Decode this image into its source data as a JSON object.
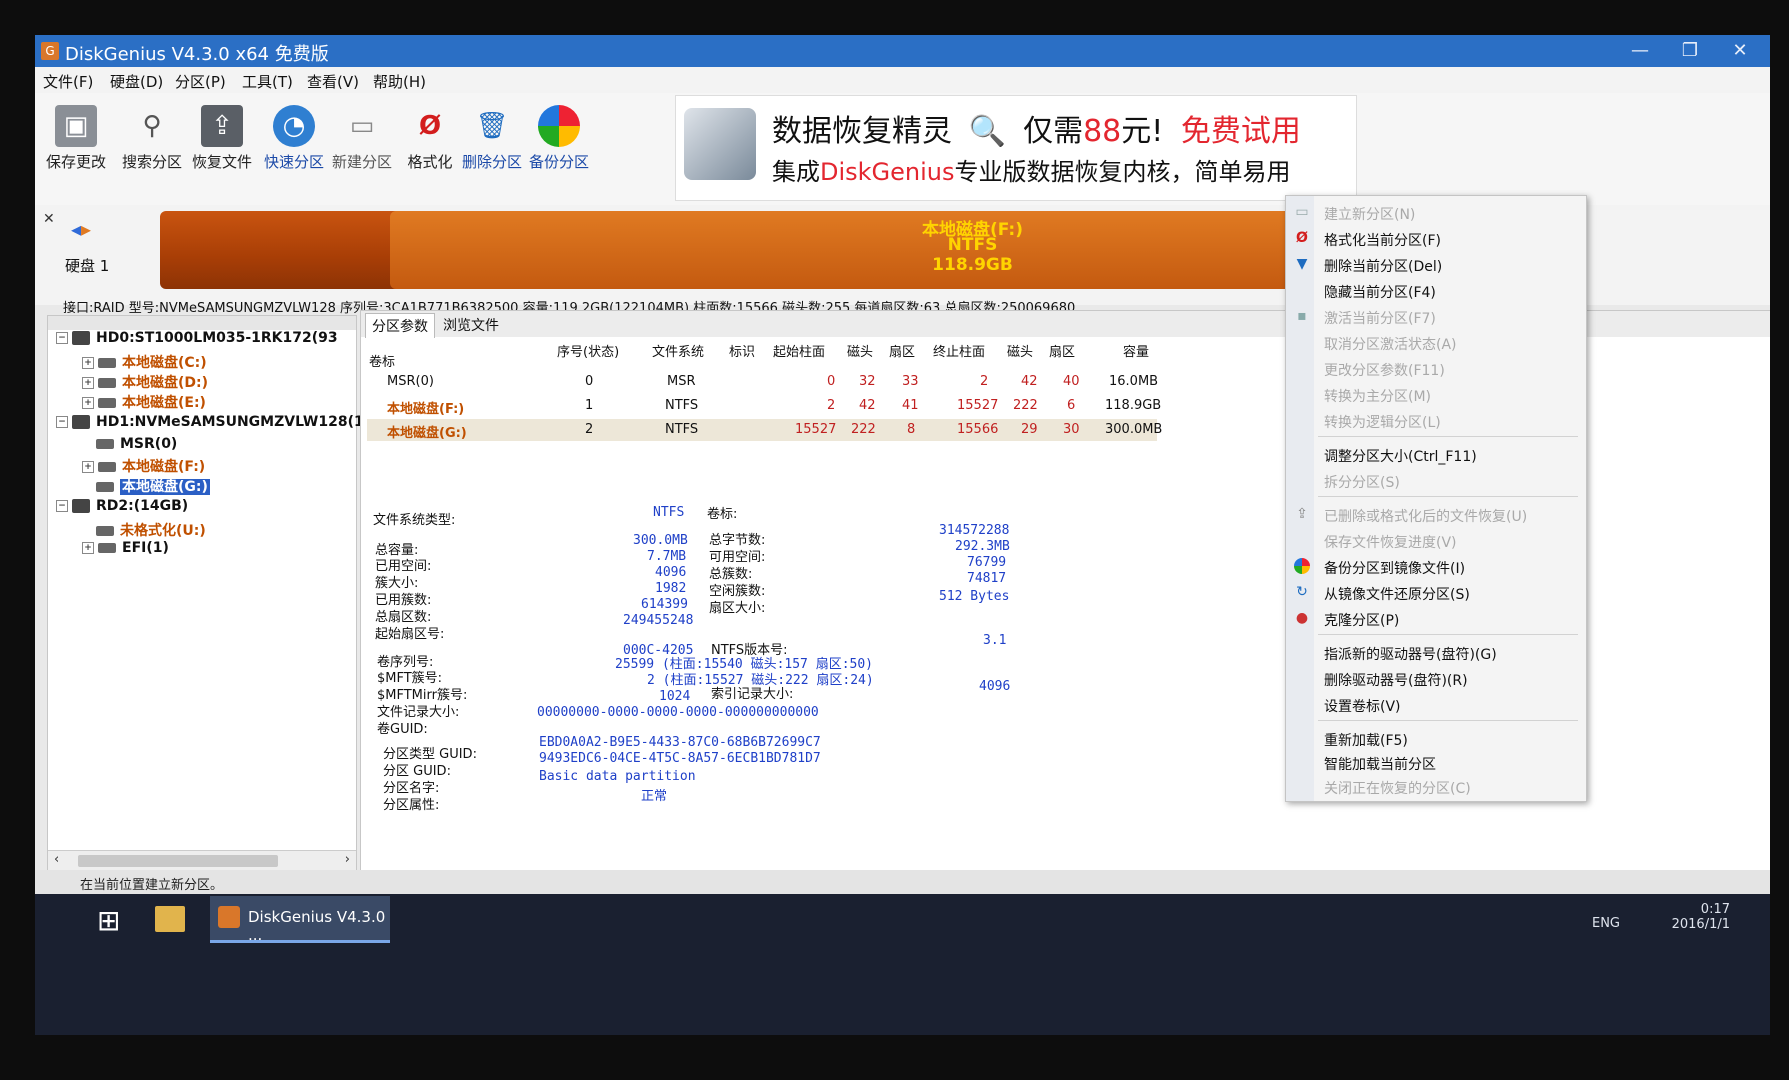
{
  "window": {
    "title": "DiskGenius V4.3.0 x64 免费版",
    "minimize": "—",
    "restore": "❐",
    "close": "✕"
  },
  "menu": [
    "文件(F)",
    "硬盘(D)",
    "分区(P)",
    "工具(T)",
    "查看(V)",
    "帮助(H)"
  ],
  "toolbar": [
    {
      "label": "保存更改",
      "icon": "save-icon"
    },
    {
      "label": "搜索分区",
      "icon": "search-icon"
    },
    {
      "label": "恢复文件",
      "icon": "recover-icon"
    },
    {
      "label": "快速分区",
      "icon": "quick-partition-icon"
    },
    {
      "label": "新建分区",
      "icon": "new-partition-icon"
    },
    {
      "label": "格式化",
      "icon": "format-icon"
    },
    {
      "label": "删除分区",
      "icon": "delete-icon"
    },
    {
      "label": "备份分区",
      "icon": "backup-icon"
    }
  ],
  "banner": {
    "t1": "数据恢复精灵",
    "t2": "仅需",
    "t3": "88",
    "t4": "元!",
    "t5": "免费试用",
    "l2a": "集成",
    "l2b": "DiskGenius",
    "l2c": "专业版数据恢复内核，简单易用"
  },
  "disk_bar": {
    "name": "本地磁盘(F:)",
    "fs": "NTFS",
    "size": "118.9GB",
    "disk_label": "硬盘 1"
  },
  "disk_info": "接口:RAID   型号:NVMeSAMSUNGMZVLW128   序列号:3CA1B771B6382500   容量:119.2GB(122104MB)   柱面数:15566   磁头数:255   每道扇区数:63   总扇区数:250069680",
  "tree": [
    {
      "text": "HD0:ST1000LM035-1RK172(93",
      "style": "black",
      "hdd": true
    },
    {
      "text": "本地磁盘(C:)",
      "style": "orange"
    },
    {
      "text": "本地磁盘(D:)",
      "style": "orange"
    },
    {
      "text": "本地磁盘(E:)",
      "style": "orange"
    },
    {
      "text": "HD1:NVMeSAMSUNGMZVLW128(1",
      "style": "black",
      "hdd": true
    },
    {
      "text": "MSR(0)",
      "style": "black"
    },
    {
      "text": "本地磁盘(F:)",
      "style": "orange"
    },
    {
      "text": "本地磁盘(G:)",
      "style": "selected"
    },
    {
      "text": "RD2:(14GB)",
      "style": "black",
      "hdd": true
    },
    {
      "text": "未格式化(U:)",
      "style": "orange"
    },
    {
      "text": "EFI(1)",
      "style": "black"
    }
  ],
  "tabs": [
    "分区参数",
    "浏览文件"
  ],
  "table": {
    "headers": [
      "卷标",
      "序号(状态)",
      "文件系统",
      "标识",
      "起始柱面",
      "磁头",
      "扇区",
      "终止柱面",
      "磁头",
      "扇区",
      "容量"
    ],
    "rows": [
      [
        "MSR(0)",
        "0",
        "MSR",
        "",
        "0",
        "32",
        "33",
        "2",
        "42",
        "40",
        "16.0MB"
      ],
      [
        "本地磁盘(F:)",
        "1",
        "NTFS",
        "",
        "2",
        "42",
        "41",
        "15527",
        "222",
        "6",
        "118.9GB"
      ],
      [
        "本地磁盘(G:)",
        "2",
        "NTFS",
        "",
        "15527",
        "222",
        "8",
        "15566",
        "29",
        "30",
        "300.0MB"
      ]
    ]
  },
  "details": {
    "fs_type_label": "文件系统类型:",
    "fs_type": "NTFS",
    "vol_label": "卷标:",
    "left_labels": [
      "总容量:",
      "已用空间:",
      "簇大小:",
      "已用簇数:",
      "总扇区数:",
      "起始扇区号:"
    ],
    "left_values": [
      "300.0MB",
      "7.7MB",
      "4096",
      "1982",
      "614399",
      "249455248"
    ],
    "right_labels": [
      "总字节数:",
      "可用空间:",
      "总簇数:",
      "空闲簇数:",
      "扇区大小:"
    ],
    "right_values": [
      "314572288",
      "292.3MB",
      "76799",
      "74817",
      "512 Bytes"
    ],
    "b_labels": [
      "卷序列号:",
      "$MFT簇号:",
      "$MFTMirr簇号:",
      "文件记录大小:",
      "卷GUID:"
    ],
    "serial": "000C-4205",
    "ntfs_ver_label": "NTFS版本号:",
    "ntfs_ver": "3.1",
    "mft": "25599 (柱面:15540 磁头:157 扇区:50)",
    "mftmirr": "2 (柱面:15527 磁头:222 扇区:24)",
    "record_size": "1024",
    "index_label": "索引记录大小:",
    "index_size": "4096",
    "vol_guid": "00000000-0000-0000-0000-000000000000",
    "c_labels": [
      "分区类型 GUID:",
      "分区 GUID:",
      "分区名字:",
      "分区属性:"
    ],
    "type_guid": "EBD0A0A2-B9E5-4433-87C0-68B6B72699C7",
    "part_guid": "9493EDC6-04CE-4T5C-8A57-6ECB1BD781D7",
    "part_name": "Basic data partition",
    "part_attr": "正常"
  },
  "context_menu": [
    {
      "label": "建立新分区(N)",
      "enabled": false,
      "icon": "new-partition-icon"
    },
    {
      "label": "格式化当前分区(F)",
      "enabled": true,
      "icon": "format-icon"
    },
    {
      "label": "删除当前分区(Del)",
      "enabled": true,
      "icon": "delete-icon"
    },
    {
      "label": "隐藏当前分区(F4)",
      "enabled": true,
      "icon": ""
    },
    {
      "label": "激活当前分区(F7)",
      "enabled": false,
      "icon": "activate-icon"
    },
    {
      "label": "取消分区激活状态(A)",
      "enabled": false,
      "icon": ""
    },
    {
      "label": "更改分区参数(F11)",
      "enabled": false,
      "icon": ""
    },
    {
      "label": "转换为主分区(M)",
      "enabled": false,
      "icon": ""
    },
    {
      "label": "转换为逻辑分区(L)",
      "enabled": false,
      "icon": ""
    },
    {
      "sep": true
    },
    {
      "label": "调整分区大小(Ctrl_F11)",
      "enabled": true,
      "icon": ""
    },
    {
      "label": "拆分分区(S)",
      "enabled": false,
      "icon": ""
    },
    {
      "sep": true
    },
    {
      "label": "已删除或格式化后的文件恢复(U)",
      "enabled": false,
      "icon": "recover-icon"
    },
    {
      "label": "保存文件恢复进度(V)",
      "enabled": false,
      "icon": ""
    },
    {
      "label": "备份分区到镜像文件(I)",
      "enabled": true,
      "icon": "backup-icon"
    },
    {
      "label": "从镜像文件还原分区(S)",
      "enabled": true,
      "icon": "restore-icon"
    },
    {
      "label": "克隆分区(P)",
      "enabled": true,
      "icon": "clone-icon"
    },
    {
      "sep": true
    },
    {
      "label": "指派新的驱动器号(盘符)(G)",
      "enabled": true,
      "icon": ""
    },
    {
      "label": "删除驱动器号(盘符)(R)",
      "enabled": true,
      "icon": ""
    },
    {
      "label": "设置卷标(V)",
      "enabled": true,
      "icon": ""
    },
    {
      "sep": true
    },
    {
      "label": "重新加载(F5)",
      "enabled": true,
      "icon": ""
    },
    {
      "label": "智能加载当前分区",
      "enabled": true,
      "icon": ""
    },
    {
      "label": "关闭正在恢复的分区(C)",
      "enabled": false,
      "icon": ""
    }
  ],
  "status": "在当前位置建立新分区。",
  "taskbar": {
    "app": "DiskGenius V4.3.0 ...",
    "lang": "ENG",
    "time": "0:17",
    "date": "2016/1/1"
  }
}
